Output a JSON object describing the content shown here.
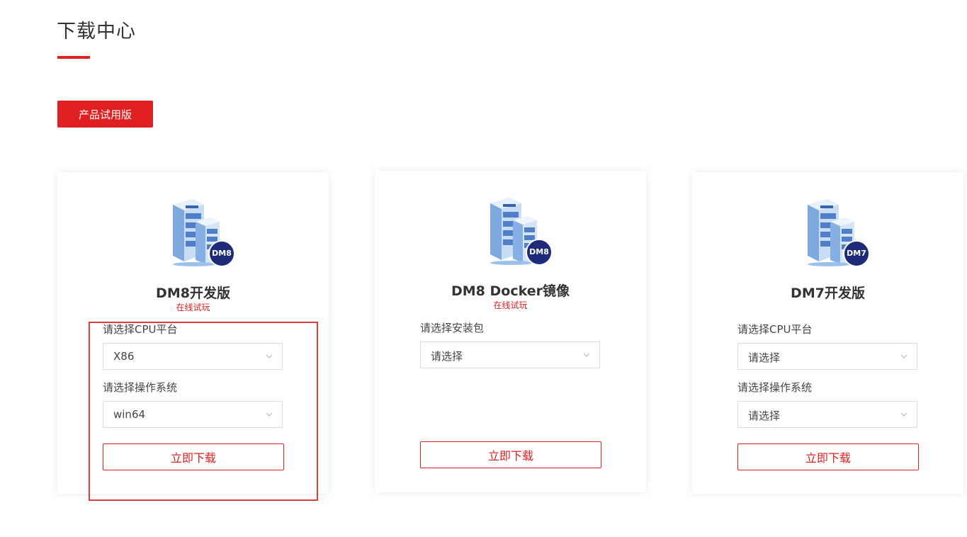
{
  "page": {
    "title": "下载中心"
  },
  "tabs": {
    "trial_label": "产品试用版"
  },
  "colors": {
    "accent": "#e02020",
    "icon_badge": "#1e2a7a",
    "server_blue": "#5b8fd6"
  },
  "cards": [
    {
      "icon": "server-stack-icon",
      "badge": "DM8",
      "title": "DM8开发版",
      "link": "在线试玩",
      "cpu_label": "请选择CPU平台",
      "cpu_value": "X86",
      "os_label": "请选择操作系统",
      "os_value": "win64",
      "download_label": "立即下载"
    },
    {
      "icon": "server-stack-icon",
      "badge": "DM8",
      "title": "DM8 Docker镜像",
      "link": "在线试玩",
      "pkg_label": "请选择安装包",
      "pkg_value": "请选择",
      "download_label": "立即下载"
    },
    {
      "icon": "server-stack-icon",
      "badge": "DM7",
      "title": "DM7开发版",
      "cpu_label": "请选择CPU平台",
      "cpu_value": "请选择",
      "os_label": "请选择操作系统",
      "os_value": "请选择",
      "download_label": "立即下载"
    }
  ]
}
